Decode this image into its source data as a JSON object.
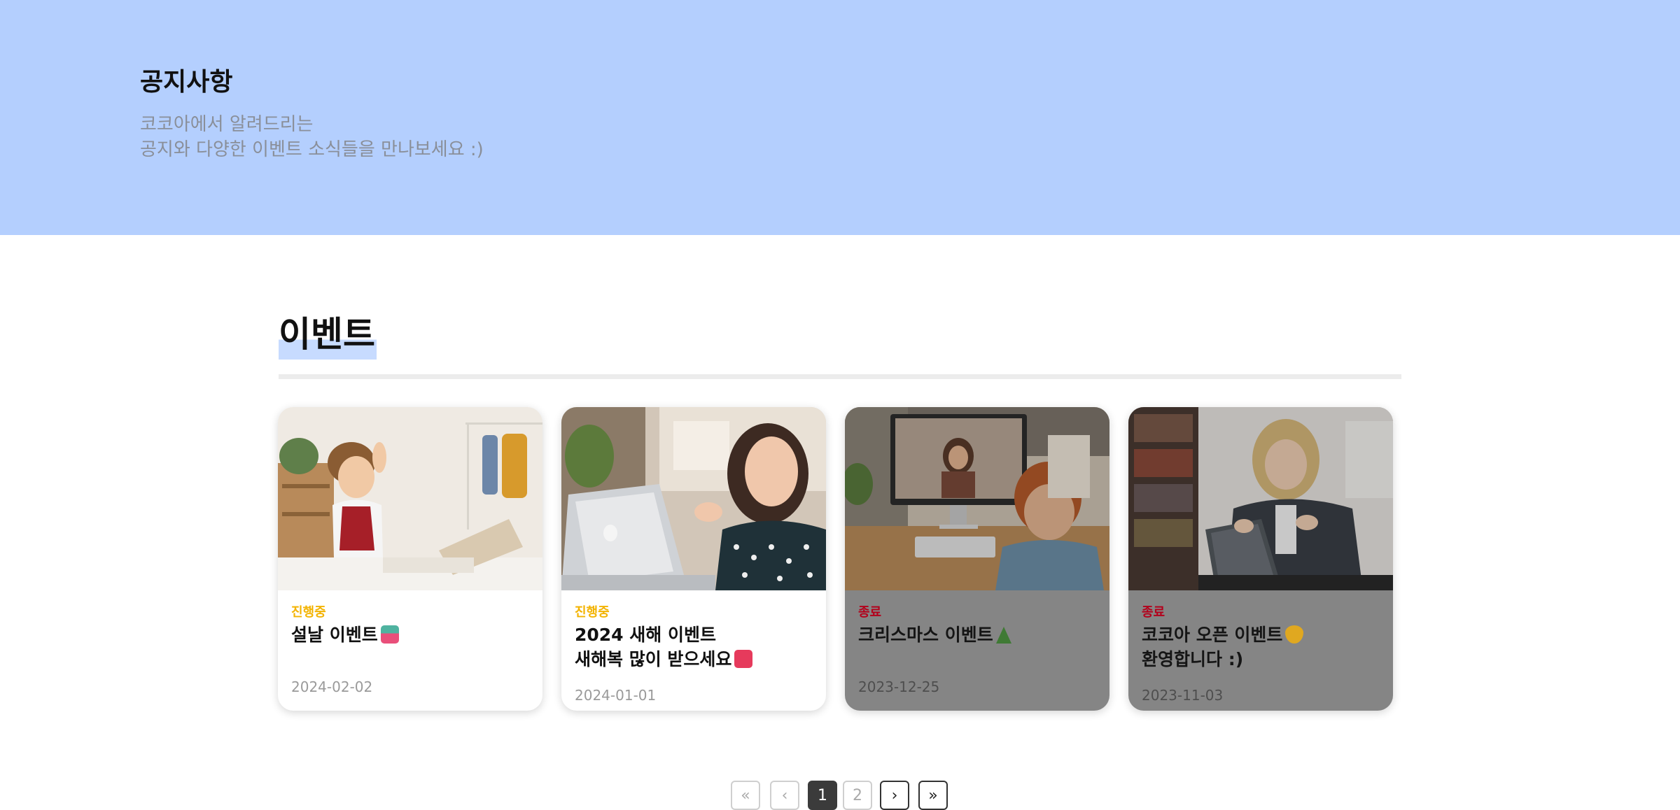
{
  "hero": {
    "title": "공지사항",
    "subtitle_line1": "코코아에서 알려드리는",
    "subtitle_line2": "공지와 다양한 이벤트 소식들을 만나보세요 :)"
  },
  "section": {
    "title": "이벤트"
  },
  "events": [
    {
      "status": "진행중",
      "title_line1": "설날 이벤트",
      "title_line2": "",
      "emoji": "lucky-bag-emoji",
      "date": "2024-02-02"
    },
    {
      "status": "진행중",
      "title_line1": "2024 새해 이벤트",
      "title_line2": "새해복 많이 받으세요",
      "emoji": "red-envelope-emoji",
      "date": "2024-01-01"
    },
    {
      "status": "종료",
      "title_line1": "크리스마스 이벤트",
      "title_line2": "",
      "emoji": "christmas-tree-emoji",
      "date": "2023-12-25"
    },
    {
      "status": "종료",
      "title_line1": "코코아 오픈 이벤트",
      "title_line2": "환영합니다 :)",
      "emoji": "yellow-heart-emoji",
      "date": "2023-11-03"
    }
  ],
  "pagination": {
    "first": "«",
    "prev": "‹",
    "pages": [
      "1",
      "2"
    ],
    "current": "1",
    "next": "›",
    "last": "»"
  },
  "colors": {
    "hero_bg": "#b4cffe",
    "status_ongoing": "#f3b300",
    "status_ended": "#b3001b",
    "ended_card_bg": "#858585"
  }
}
